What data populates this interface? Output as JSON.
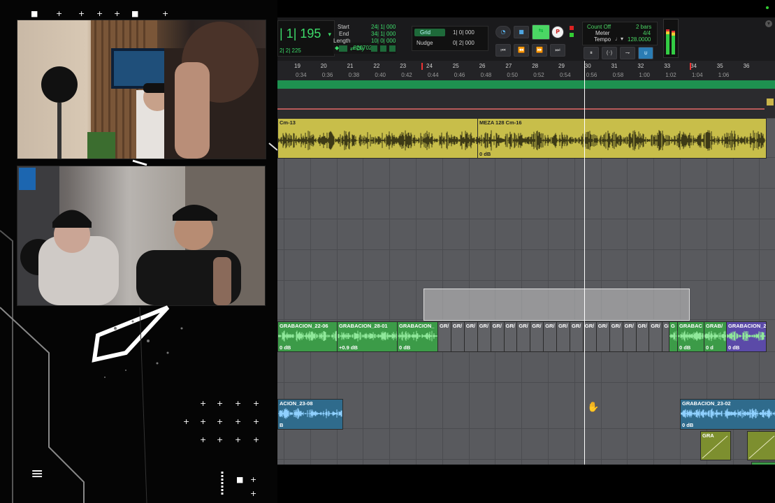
{
  "counter": {
    "main": "| 1| 195",
    "sub": "2| 2| 225",
    "offset": "-820702",
    "dly": "Dly"
  },
  "selection": {
    "start_label": "Start",
    "start_value": "24| 1| 000",
    "end_label": "End",
    "end_value": "34| 1| 000",
    "length_label": "Length",
    "length_value": "10| 0| 000"
  },
  "grid": {
    "grid_label": "Grid",
    "grid_value": "1| 0| 000",
    "nudge_label": "Nudge",
    "nudge_value": "0| 2| 000"
  },
  "countoff": {
    "title": "Count Off",
    "bars": "2 bars",
    "meter_label": "Meter",
    "meter_value": "4/4",
    "tempo_label": "Tempo",
    "tempo_value": "128.0000"
  },
  "ruler": {
    "bars": [
      "19",
      "20",
      "21",
      "22",
      "23",
      "24",
      "25",
      "26",
      "27",
      "28",
      "29",
      "30",
      "31",
      "32",
      "33",
      "34",
      "35",
      "36"
    ],
    "times": [
      "0:34",
      "0:36",
      "0:38",
      "0:40",
      "0:42",
      "0:44",
      "0:46",
      "0:48",
      "0:50",
      "0:52",
      "0:54",
      "0:56",
      "0:58",
      "1:00",
      "1:02",
      "1:04",
      "1:06"
    ]
  },
  "clips": {
    "yellow1": {
      "name": "Cm-13"
    },
    "yellow2": {
      "name": "MEZA 128 Cm-16",
      "gain": "0 dB"
    },
    "g1": {
      "name": "GRABACION_22-06",
      "gain": "0 dB"
    },
    "g2": {
      "name": "GRABACION_28-01",
      "gain": "+0.9 dB"
    },
    "g3": {
      "name": "GRABACION_",
      "gain": "0 dB"
    },
    "small": [
      "GR/",
      "GR/",
      "GR/",
      "GR/",
      "GR/",
      "GR/",
      "GR/",
      "GR/",
      "GR/",
      "GR/",
      "GR/",
      "GR/",
      "GR/",
      "GR/",
      "GR/",
      "GR/",
      "GR/",
      "GR/"
    ],
    "g4": {
      "name": "G"
    },
    "g5": {
      "name": "GRABAC",
      "gain": "0 dB"
    },
    "g6": {
      "name": "GRAB/",
      "gain": "0 d"
    },
    "p1": {
      "name": "GRABACION_2",
      "gain": "0 dB"
    },
    "b1": {
      "name": "ACION_23-08",
      "gain": "B"
    },
    "b2": {
      "name": "GRABACION_23-02",
      "gain": "0 dB"
    },
    "o1": {
      "name": "GRA"
    }
  },
  "colors": {
    "yellow": "#c8be4a",
    "green": "#3c9b48",
    "blue": "#2f6b8c",
    "purple": "#5b4aa8",
    "olive": "#7d8f2f"
  },
  "overlay": {
    "logo_glyph": "≡"
  }
}
